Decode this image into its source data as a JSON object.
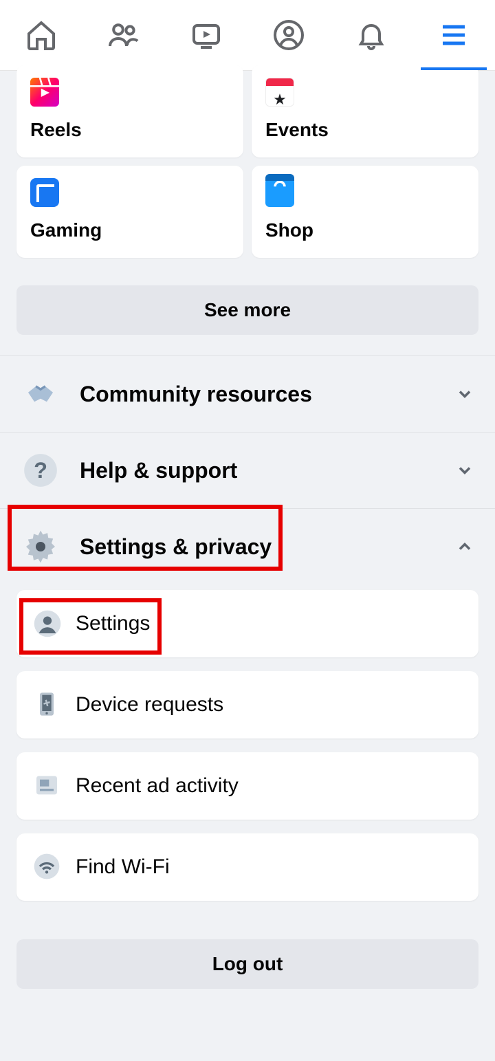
{
  "shortcuts": [
    {
      "label": "Reels"
    },
    {
      "label": "Events"
    },
    {
      "label": "Gaming"
    },
    {
      "label": "Shop"
    }
  ],
  "see_more": "See more",
  "sections": {
    "community": "Community resources",
    "help": "Help & support",
    "settings_privacy": "Settings & privacy"
  },
  "submenu": {
    "settings": "Settings",
    "device": "Device requests",
    "adactivity": "Recent ad activity",
    "wifi": "Find Wi-Fi"
  },
  "logout": "Log out"
}
